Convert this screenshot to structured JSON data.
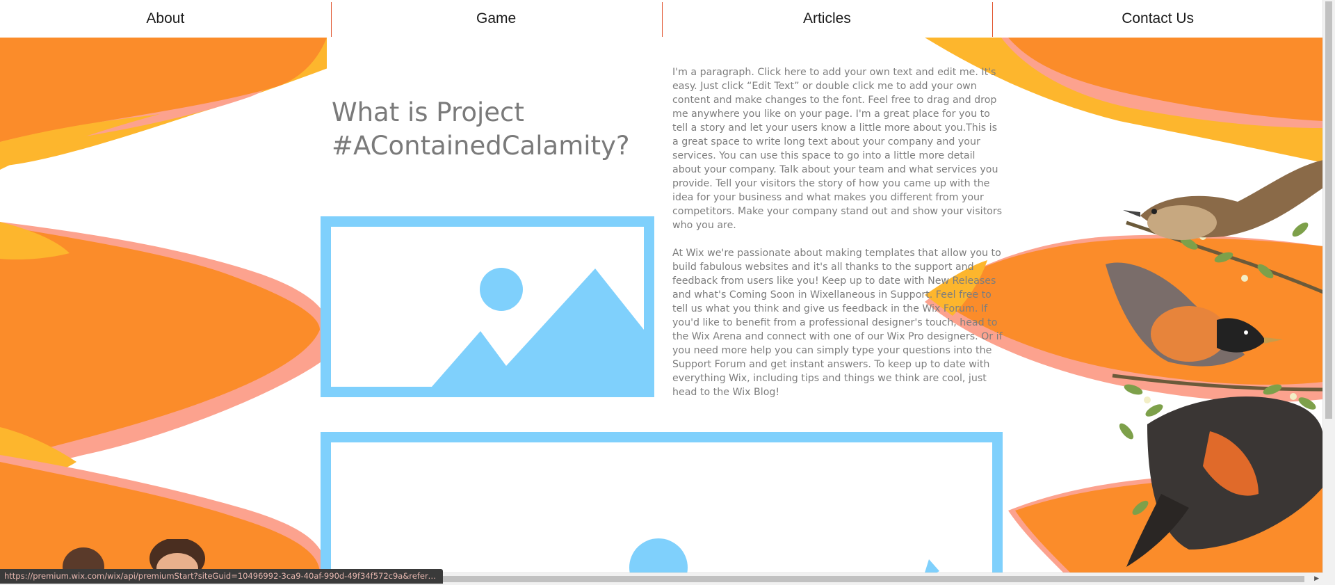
{
  "nav": {
    "items": [
      {
        "label": "About"
      },
      {
        "label": "Game"
      },
      {
        "label": "Articles"
      },
      {
        "label": "Contact Us"
      }
    ]
  },
  "main": {
    "title": "What is Project #AContainedCalamity?",
    "paragraph1": "I'm a paragraph. Click here to add your own text and edit me. It's easy. Just click “Edit Text” or double click me to add your own content and make changes to the font. Feel free to drag and drop me anywhere you like on your page. I'm a great place for you to tell a story and let your users know a little more about you.This is a great space to write long text about your company and your services. You can use this space to go into a little more detail about your company. Talk about your team and what services you provide. Tell your visitors the story of how you came up with the idea for your business and what makes you different from your competitors. Make your company stand out and show your visitors who you are.",
    "paragraph2": "At Wix we're passionate about making templates that allow you to build fabulous websites and it's all thanks to the support and feedback from users like you! Keep up to date with New Releases and what's Coming Soon in Wixellaneous in Support. Feel free to tell us what you think and give us feedback in the Wix Forum. If you'd like to benefit from a professional designer's touch, head to the Wix Arena and connect with one of our Wix Pro designers. Or if you need more help you can simply type your questions into the Support Forum and get instant answers. To keep up to date with everything Wix, including tips and things we think are cool, just head to the Wix Blog!"
  },
  "status_bar": {
    "url": "https://premium.wix.com/wix/api/premiumStart?siteGuid=10496992-3ca9-40af-990d-49f34f572c9a&referralAddition..."
  },
  "colors": {
    "accent_orange": "#fb8c2a",
    "accent_yellow": "#fdb62d",
    "accent_salmon": "#fca28e",
    "placeholder_blue": "#7fd0fc",
    "nav_divider": "#e0522b"
  },
  "icons": {
    "placeholder": "image-placeholder-icon",
    "scroll_left": "arrow-left-icon",
    "scroll_right": "arrow-right-icon",
    "scroll_up": "arrow-up-icon",
    "scroll_down": "arrow-down-icon"
  }
}
